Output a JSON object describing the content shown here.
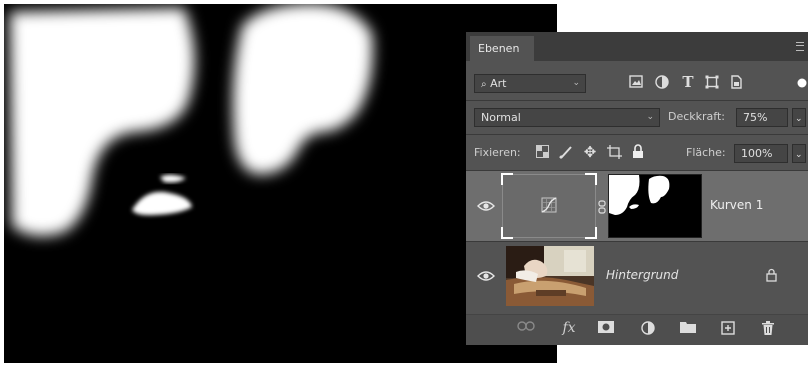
{
  "panel": {
    "tab_label": "Ebenen",
    "filter": {
      "value": "Art"
    },
    "blend_mode": {
      "value": "Normal"
    },
    "opacity": {
      "label": "Deckkraft:",
      "value": "75%"
    },
    "lock": {
      "label": "Fixieren:"
    },
    "fill": {
      "label": "Fläche:",
      "value": "100%"
    },
    "layers": [
      {
        "name": "Kurven 1",
        "type": "adjustment-curves",
        "selected": true,
        "visible": true
      },
      {
        "name": "Hintergrund",
        "type": "image",
        "locked": true,
        "visible": true
      }
    ],
    "footer_icons": [
      "link-icon",
      "fx-icon",
      "mask-icon",
      "adjustment-icon",
      "folder-icon",
      "new-layer-icon",
      "trash-icon"
    ]
  },
  "colors": {
    "panel_bg": "#535353",
    "selected_layer_bg": "#6e6e6e",
    "tab_bar_bg": "#3c3c3c",
    "canvas_bg": "#000000",
    "mask_white": "#ffffff"
  }
}
